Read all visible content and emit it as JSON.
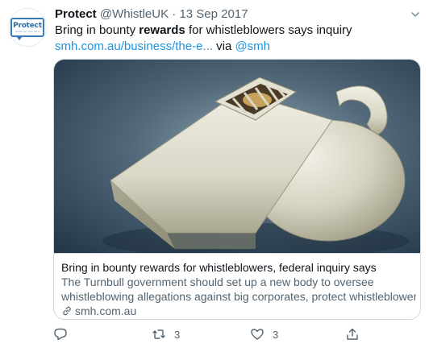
{
  "tweet": {
    "author_name": "Protect",
    "author_handle": "@WhistleUK",
    "separator": "·",
    "date": "13 Sep 2017",
    "avatar": {
      "logo_text": "Protect",
      "logo_sub": "speak up, stop harm",
      "color": "#3a7ab8"
    },
    "text_before": "Bring in bounty ",
    "text_bold": "rewards",
    "text_after": " for whistleblowers says inquiry",
    "link_text": "smh.com.au/business/the-e...",
    "via_text": " via ",
    "mention": "@smh"
  },
  "card": {
    "image_icon": "whistle-illustration",
    "title": "Bring in bounty rewards for whistleblowers, federal inquiry says",
    "description_line1": "The Turnbull government should set up a new body to oversee",
    "description_line2": "whistleblowing allegations against big corporates, protect whistleblower...",
    "domain": "smh.com.au"
  },
  "actions": {
    "reply_icon": "reply-icon",
    "retweet_icon": "retweet-icon",
    "retweet_count": "3",
    "like_icon": "heart-icon",
    "like_count": "3",
    "share_icon": "share-icon"
  },
  "colors": {
    "link": "#1b95e0",
    "secondary": "#536471",
    "border": "#cfd9de"
  }
}
